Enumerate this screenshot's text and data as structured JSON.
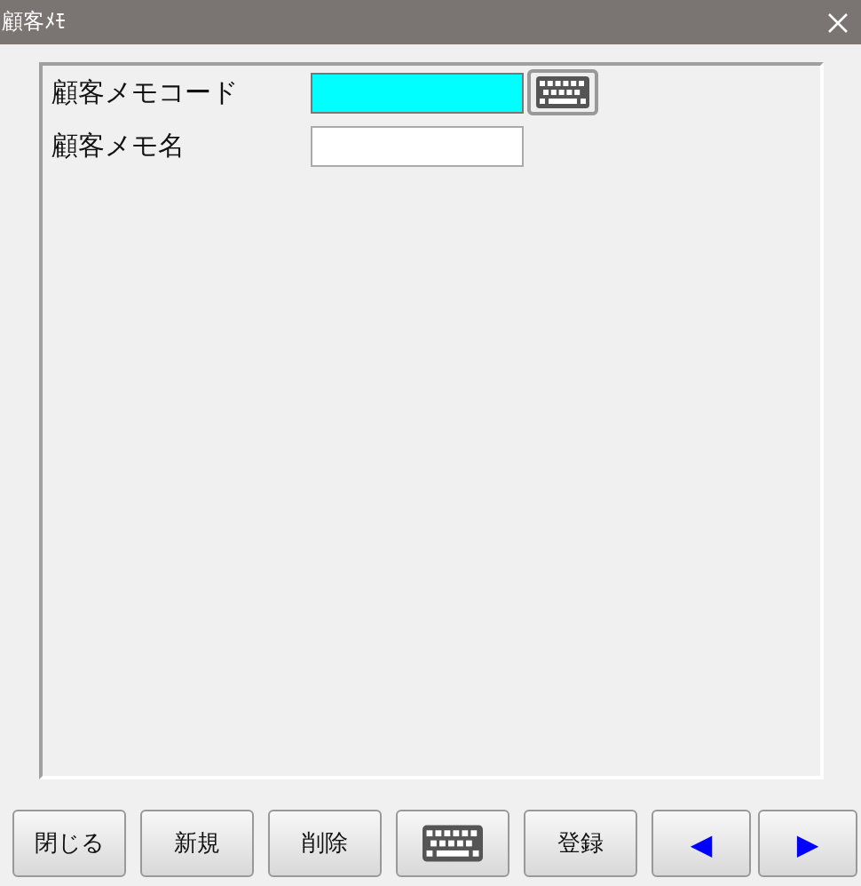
{
  "window": {
    "title": "顧客ﾒﾓ"
  },
  "fields": [
    {
      "label": "顧客メモコード",
      "focused": true,
      "keyboard": true
    },
    {
      "label": "顧客メモ名",
      "focused": false,
      "keyboard": false
    }
  ],
  "buttons": [
    {
      "kind": "text",
      "label": "閉じる"
    },
    {
      "kind": "text",
      "label": "新規"
    },
    {
      "kind": "text",
      "label": "削除"
    },
    {
      "kind": "keyboard"
    },
    {
      "kind": "text",
      "label": "登録"
    },
    {
      "kind": "arrow",
      "label": "◀"
    },
    {
      "kind": "arrow",
      "label": "▶"
    }
  ]
}
